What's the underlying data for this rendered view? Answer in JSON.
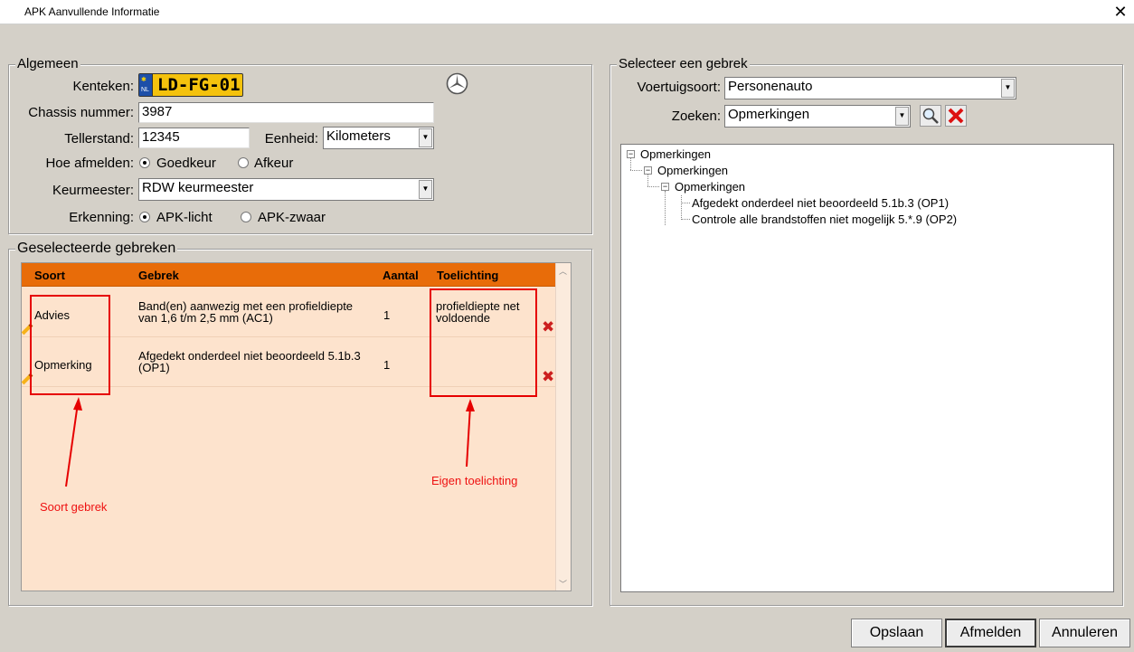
{
  "window": {
    "title": "APK Aanvullende Informatie",
    "close_glyph": "✕"
  },
  "algemeen": {
    "legend": "Algemeen",
    "kenteken_label": "Kenteken:",
    "kenteken_value": "LD-FG-01",
    "plate_country": "NL",
    "brand_logo_icon": "mercedes-star-icon",
    "chassis_label": "Chassis nummer:",
    "chassis_value": "3987",
    "tellerstand_label": "Tellerstand:",
    "tellerstand_value": "12345",
    "eenheid_label": "Eenheid:",
    "eenheid_value": "Kilometers",
    "afmelden_label": "Hoe afmelden:",
    "afmelden_options": [
      "Goedkeur",
      "Afkeur"
    ],
    "afmelden_selected": "Goedkeur",
    "keurmeester_label": "Keurmeester:",
    "keurmeester_value": "RDW keurmeester",
    "erkenning_label": "Erkenning:",
    "erkenning_options": [
      "APK-licht",
      "APK-zwaar"
    ],
    "erkenning_selected": "APK-licht"
  },
  "gebreken": {
    "legend": "Geselecteerde gebreken",
    "columns": [
      "Soort",
      "Gebrek",
      "Aantal",
      "Toelichting"
    ],
    "header_color": "#e86c09",
    "rows": [
      {
        "soort": "Advies",
        "gebrek": "Band(en) aanwezig met een profieldiepte van 1,6 t/m 2,5 mm (AC1)",
        "aantal": "1",
        "toelichting": "profieldiepte net voldoende"
      },
      {
        "soort": "Opmerking",
        "gebrek": "Afgedekt onderdeel niet beoordeeld 5.1b.3 (OP1)",
        "aantal": "1",
        "toelichting": ""
      }
    ]
  },
  "annotations": {
    "soort": "Soort gebrek",
    "toelichting": "Eigen toelichting",
    "color": "#e60000"
  },
  "selecteer": {
    "legend": "Selecteer een gebrek",
    "voertuigsoort_label": "Voertuigsoort:",
    "voertuigsoort_value": "Personenauto",
    "zoeken_label": "Zoeken:",
    "zoeken_value": "Opmerkingen",
    "tree": [
      "Opmerkingen",
      "Opmerkingen",
      "Opmerkingen",
      "Afgedekt onderdeel niet beoordeeld 5.1b.3 (OP1)",
      "Controle alle brandstoffen niet mogelijk 5.*.9 (OP2)"
    ]
  },
  "buttons": {
    "save": "Opslaan",
    "afmelden": "Afmelden",
    "cancel": "Annuleren"
  }
}
